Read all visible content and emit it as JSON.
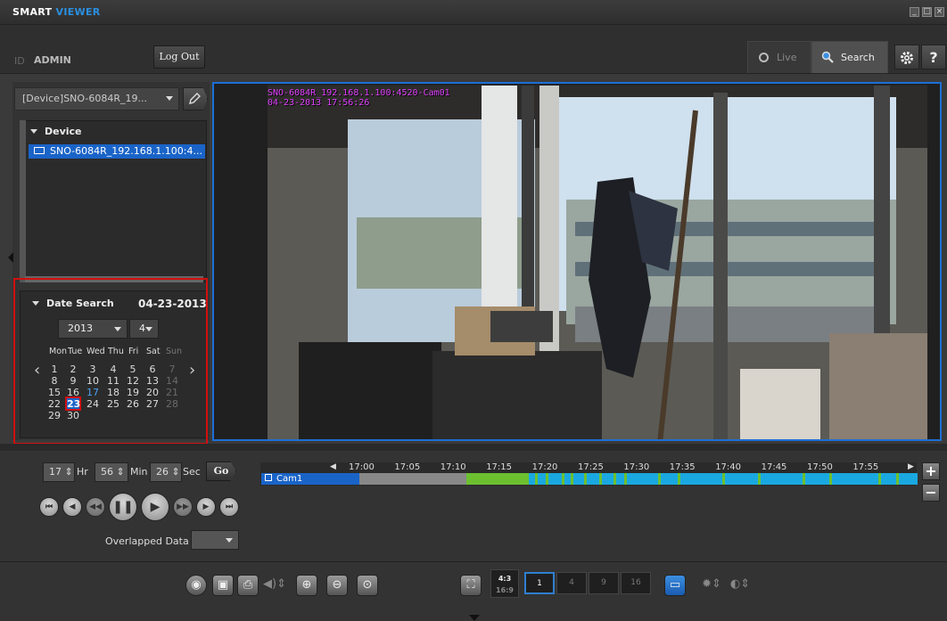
{
  "app": {
    "brand_a": "SMART",
    "brand_b": "VIEWER"
  },
  "window": {
    "minimize": "_",
    "maximize": "□",
    "close": "×"
  },
  "user": {
    "id_label": "ID",
    "name": "ADMIN",
    "logout": "Log Out"
  },
  "mode_tabs": {
    "live": "Live",
    "search": "Search"
  },
  "toolbar_top": {
    "settings_icon": "gear-icon",
    "help": "?"
  },
  "device_selector": {
    "value": "[Device]SNO-6084R_19..."
  },
  "tree": {
    "header": "Device",
    "device": "SNO-6084R_192.168.1.100:4..."
  },
  "date_search": {
    "title": "Date Search",
    "date": "04-23-2013",
    "year": "2013",
    "month": "4",
    "weekdays": [
      "Mon",
      "Tue",
      "Wed",
      "Thu",
      "Fri",
      "Sat",
      "Sun"
    ],
    "weeks": [
      [
        "1",
        "2",
        "3",
        "4",
        "5",
        "6",
        "7"
      ],
      [
        "8",
        "9",
        "10",
        "11",
        "12",
        "13",
        "14"
      ],
      [
        "15",
        "16",
        "17",
        "18",
        "19",
        "20",
        "21"
      ],
      [
        "22",
        "23",
        "24",
        "25",
        "26",
        "27",
        "28"
      ],
      [
        "29",
        "30",
        "",
        "",
        "",
        "",
        ""
      ]
    ],
    "selected": "23",
    "today": "17"
  },
  "video": {
    "overlay_line1": "SNO-6084R_192.168.1.100:4520-Cam01",
    "overlay_line2": "04-23-2013 17:56:26"
  },
  "time_input": {
    "hour": "17",
    "hour_unit": "Hr",
    "minute": "56",
    "minute_unit": "Min",
    "second": "26",
    "second_unit": "Sec",
    "go": "Go"
  },
  "timeline": {
    "camera": "Cam1",
    "ticks": [
      "17:00",
      "17:05",
      "17:10",
      "17:15",
      "17:20",
      "17:25",
      "17:30",
      "17:35",
      "17:40",
      "17:45",
      "17:50",
      "17:55"
    ],
    "zoom_in": "+",
    "zoom_out": "−",
    "colors": {
      "track": "#1aa8e0",
      "gap": "#888888",
      "motion": "#6cc030"
    }
  },
  "overlapped": {
    "label": "Overlapped Data",
    "value": ""
  },
  "aspect": {
    "top": "4:3",
    "bottom": "16:9"
  },
  "layouts": [
    "1",
    "4",
    "9",
    "16"
  ]
}
